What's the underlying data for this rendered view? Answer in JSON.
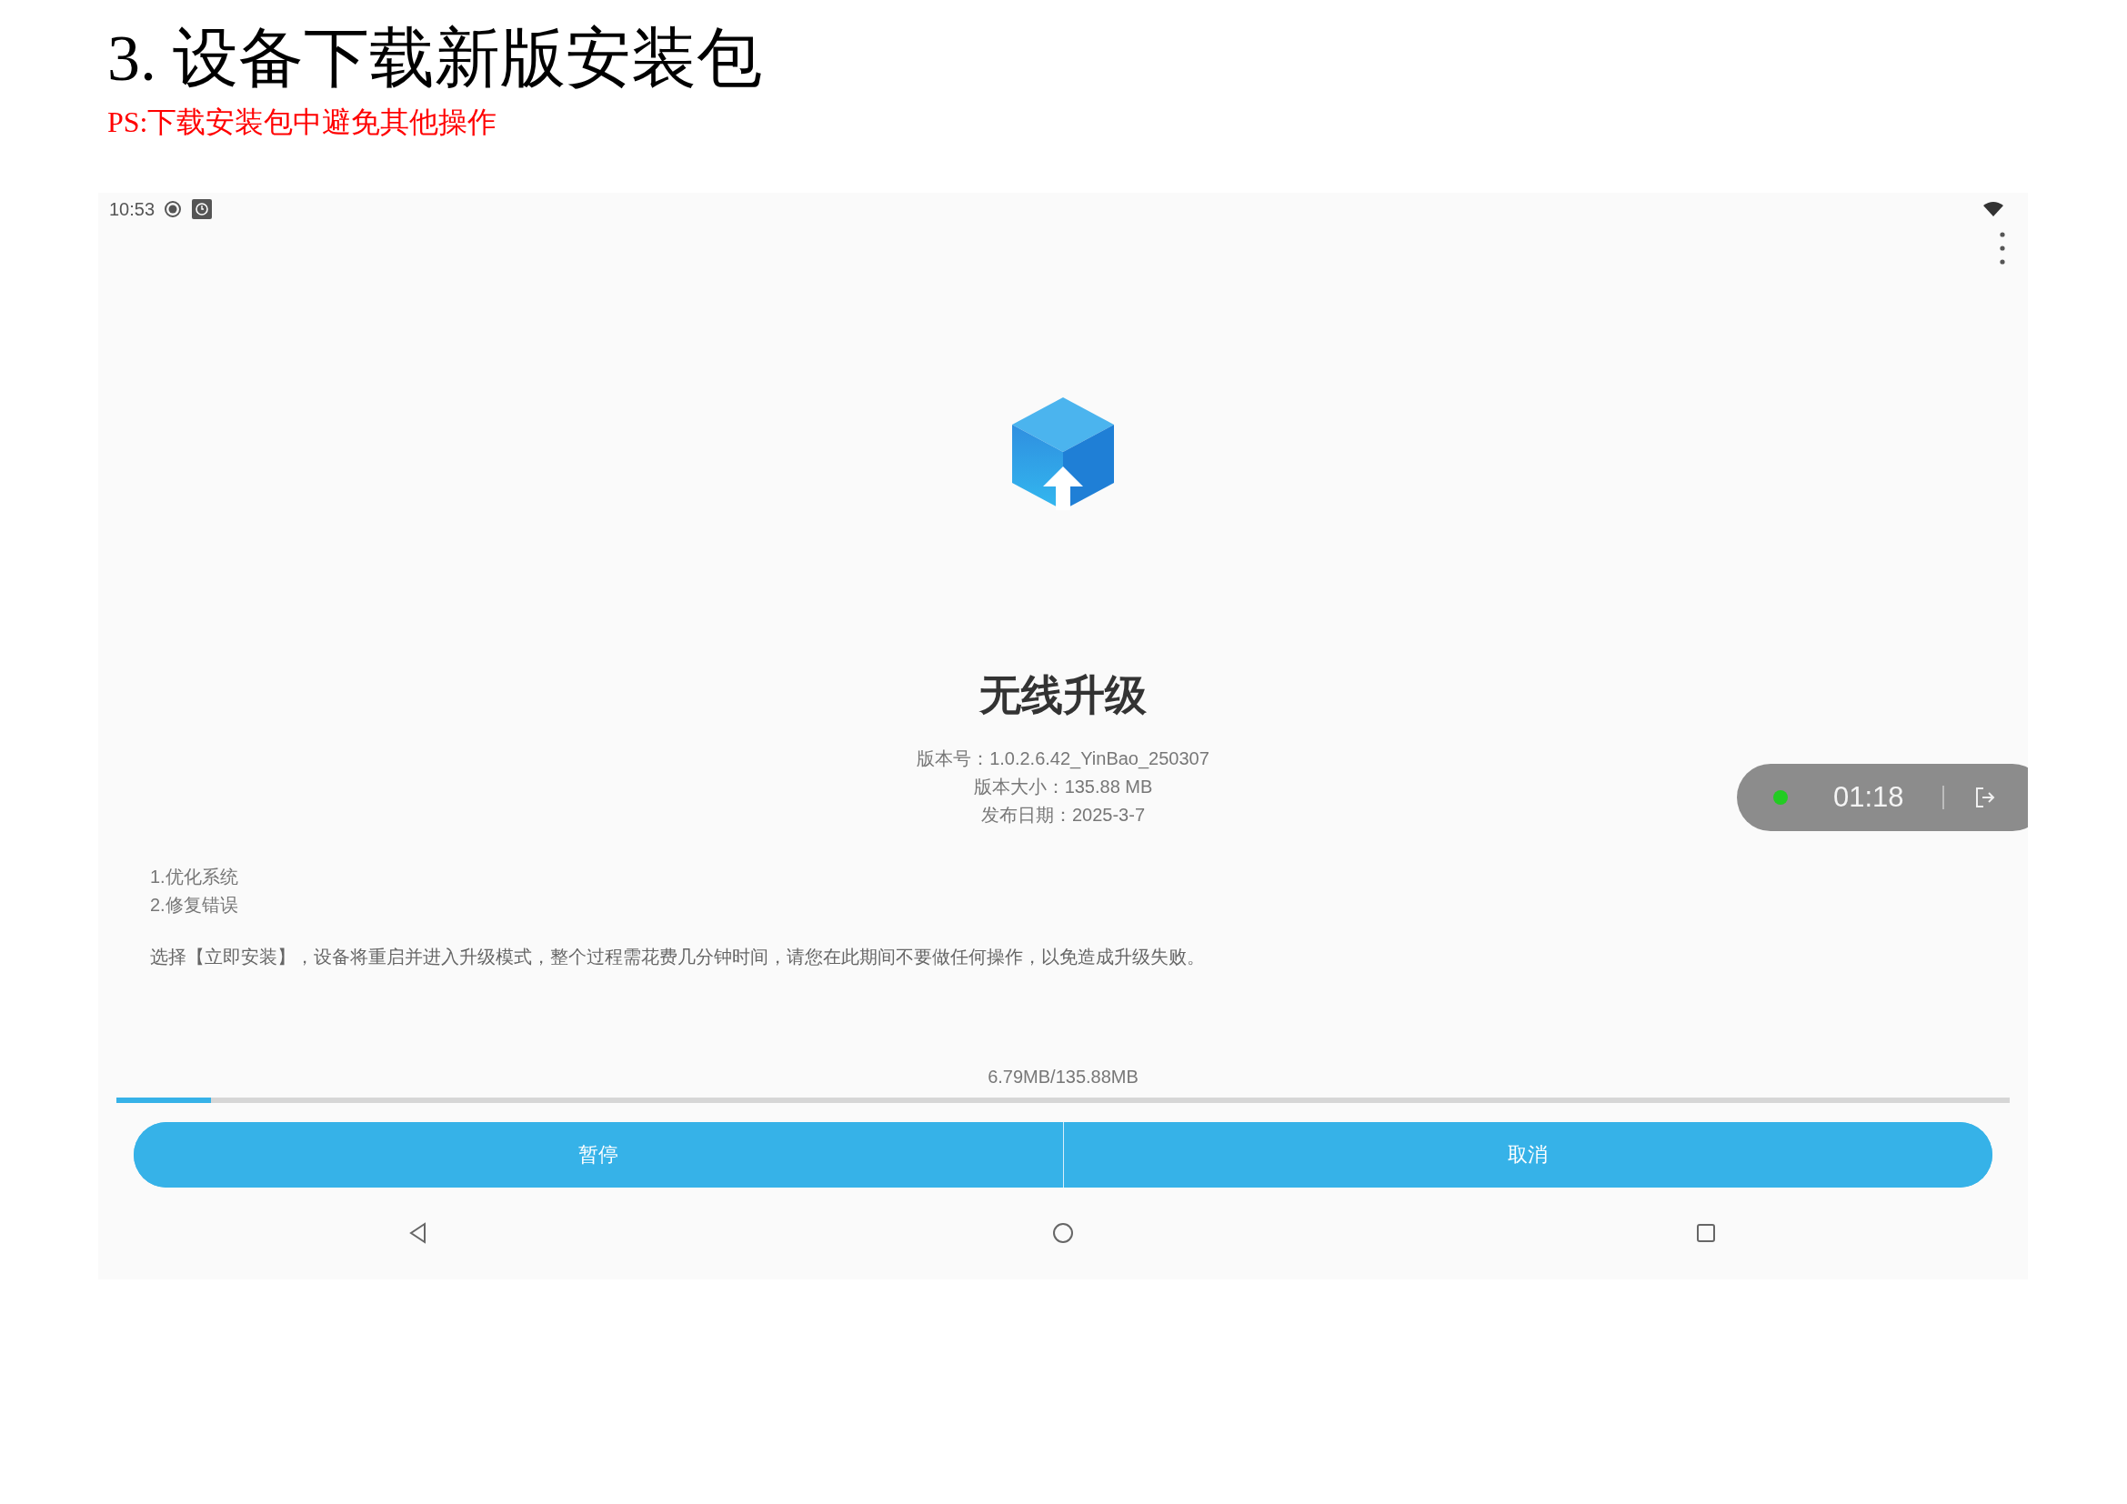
{
  "document": {
    "heading": "3. 设备下载新版安装包",
    "note": "PS:下载安装包中避免其他操作"
  },
  "status_bar": {
    "time": "10:53"
  },
  "app": {
    "title": "无线升级",
    "info": [
      "版本号：1.0.2.6.42_YinBao_250307",
      "版本大小：135.88 MB",
      "发布日期：2025-3-7"
    ],
    "changelog": [
      "1.优化系统",
      "2.修复错误"
    ],
    "notice": "选择【立即安装】，设备将重启并进入升级模式，整个过程需花费几分钟时间，请您在此期间不要做任何操作，以免造成升级失败。",
    "progress": {
      "reading": "6.79MB/135.88MB",
      "level": 0.05
    },
    "buttons": [
      {
        "label": "暂停"
      },
      {
        "label": "取消"
      }
    ]
  },
  "recorder": {
    "time": "01:18",
    "recording": true
  }
}
